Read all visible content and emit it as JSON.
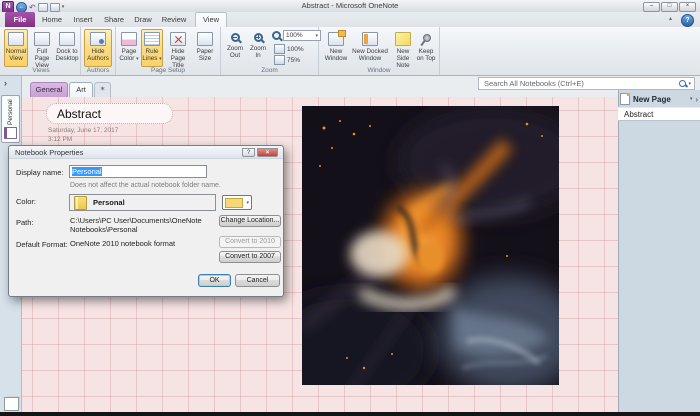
{
  "window": {
    "title": "Abstract - Microsoft OneNote",
    "logo_letter": "N",
    "controls": {
      "minimize": "–",
      "maximize": "□",
      "close": "×",
      "collapse_ribbon": "▴",
      "help": "?"
    }
  },
  "icons": {
    "dropdown": "▾",
    "chevron_right": "›",
    "back": "←",
    "undo": "↶",
    "star": "✶"
  },
  "ribbon": {
    "tabs": [
      {
        "label": "File"
      },
      {
        "label": "Home"
      },
      {
        "label": "Insert"
      },
      {
        "label": "Share"
      },
      {
        "label": "Draw"
      },
      {
        "label": "Review"
      },
      {
        "label": "View"
      }
    ],
    "views": {
      "label": "Views",
      "buttons": [
        {
          "label1": "Normal",
          "label2": "View"
        },
        {
          "label1": "Full Page",
          "label2": "View"
        },
        {
          "label1": "Dock to",
          "label2": "Desktop"
        }
      ]
    },
    "authors": {
      "label": "Authors",
      "buttons": [
        {
          "label1": "Hide",
          "label2": "Authors"
        }
      ]
    },
    "page_setup": {
      "label": "Page Setup",
      "buttons": [
        {
          "label1": "Page",
          "label2": "Color"
        },
        {
          "label1": "Rule",
          "label2": "Lines"
        },
        {
          "label1": "Hide",
          "label2": "Page Title"
        },
        {
          "label1": "Paper",
          "label2": "Size"
        }
      ]
    },
    "zoom": {
      "label": "Zoom",
      "out1": "Zoom",
      "out2": "Out",
      "in1": "Zoom",
      "in2": "In",
      "combo_value": "100%",
      "btn_100": "100%",
      "btn_75": "75%"
    },
    "window_group": {
      "label": "Window",
      "buttons": [
        {
          "label1": "New",
          "label2": "Window"
        },
        {
          "label1": "New Docked",
          "label2": "Window"
        },
        {
          "label1": "New Side",
          "label2": "Note"
        },
        {
          "label1": "Keep",
          "label2": "on Top"
        }
      ]
    }
  },
  "search": {
    "placeholder": "Search All Notebooks (Ctrl+E)"
  },
  "nav": {
    "notebook": "Personal"
  },
  "sections": {
    "tabs": [
      {
        "label": "General"
      },
      {
        "label": "Art"
      }
    ]
  },
  "page": {
    "title": "Abstract",
    "date": "Saturday, June 17, 2017",
    "time": "3:12 PM"
  },
  "panel": {
    "header": "New Page",
    "pages": [
      {
        "title": "Abstract"
      }
    ]
  },
  "dialog": {
    "title": "Notebook Properties",
    "display_name_label": "Display name:",
    "display_name_value": "Personal",
    "display_name_note": "Does not affect the actual notebook folder name.",
    "color_label": "Color:",
    "color_preview_name": "Personal",
    "path_label": "Path:",
    "path_line1": "C:\\Users\\PC User\\Documents\\OneNote",
    "path_line2": "Notebooks\\Personal",
    "default_format_label": "Default Format:",
    "default_format_value": "OneNote 2010 notebook format",
    "change_location": "Change Location...",
    "convert_2010": "Convert to 2010",
    "convert_2007": "Convert to 2007",
    "ok": "OK",
    "cancel": "Cancel"
  },
  "colors": {
    "accent_purple": "#82307f",
    "toggle_highlight": "#f9d268",
    "swatch_yellow": "#f6d876",
    "page_bg": "#f6e4e4"
  }
}
